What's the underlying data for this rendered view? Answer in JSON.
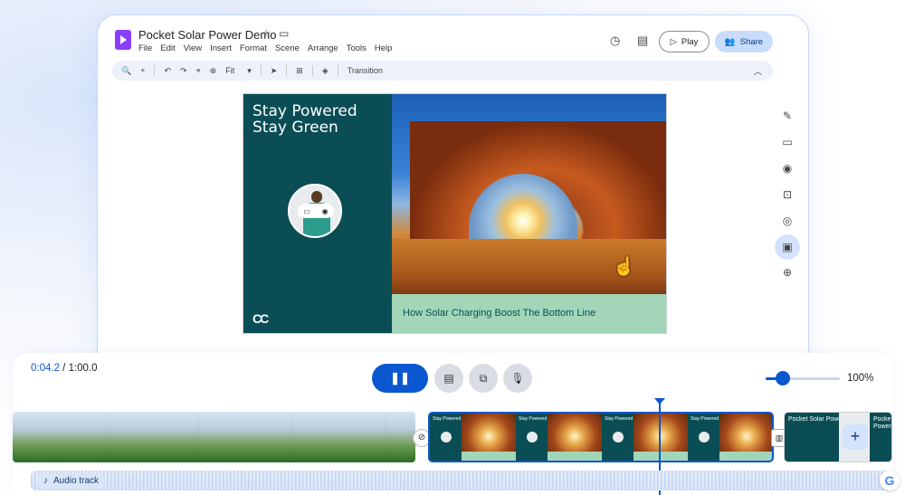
{
  "app": {
    "doc_title": "Pocket Solar Power Demo",
    "menu": [
      "File",
      "Edit",
      "View",
      "Insert",
      "Format",
      "Scene",
      "Arrange",
      "Tools",
      "Help"
    ],
    "play_label": "Play",
    "share_label": "Share"
  },
  "toolbar": {
    "zoom_select": "Fit",
    "transition_label": "Transition"
  },
  "slide": {
    "headline_line1": "Stay Powered",
    "headline_line2": "Stay Green",
    "caption": "How Solar Charging Boost The Bottom Line",
    "brand_mark": "CC"
  },
  "timeline": {
    "current_time": "0:04.2",
    "total_time": " / 1:00.0",
    "zoom_value": 100,
    "zoom_label": "100%",
    "audio_label": "Audio track",
    "mini_slide_text": "Stay Powered Stay Green",
    "next_clip_title": "Pocket Solar Power",
    "next_clip_title2": "Pocke Power"
  },
  "colors": {
    "accent": "#0b57d0",
    "slide_teal": "#0a4d55",
    "caption_green": "#a3d6b8",
    "app_purple": "#8a3ffc"
  },
  "icons": {
    "star": "star-icon",
    "folder": "move-to-folder-icon",
    "history": "history-icon",
    "comments": "comments-icon",
    "people": "people-icon"
  }
}
